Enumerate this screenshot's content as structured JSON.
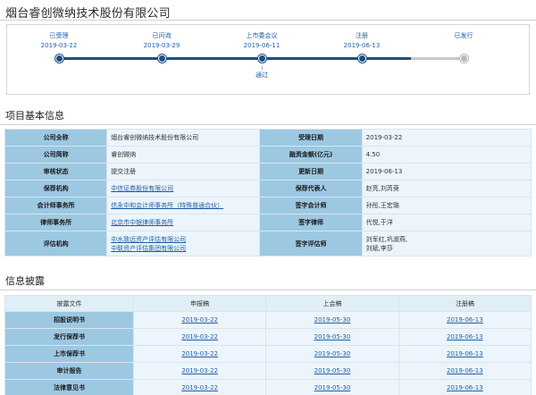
{
  "company_title": "烟台睿创微纳技术股份有限公司",
  "progress": {
    "stages": [
      {
        "label": "已受理",
        "date": "2019-03-22",
        "done": true
      },
      {
        "label": "已问询",
        "date": "2019-03-29",
        "done": true
      },
      {
        "label": "上市委会议",
        "date": "2019-06-11",
        "done": true
      },
      {
        "label": "注册",
        "date": "2019-06-13",
        "done": true
      },
      {
        "label": "已发行",
        "date": "",
        "done": false
      }
    ],
    "sub_step": "通过",
    "colors": {
      "done": "#1c4f84",
      "pending": "#c8c8c8"
    }
  },
  "basic_info": {
    "section_title": "项目基本信息",
    "rows": [
      {
        "l1": "公司全称",
        "v1": "烟台睿创微纳技术股份有限公司",
        "v1_link": false,
        "l2": "受理日期",
        "v2": "2019-03-22",
        "v2_link": false
      },
      {
        "l1": "公司简称",
        "v1": "睿创微纳",
        "v1_link": false,
        "l2": "融资金额(亿元)",
        "v2": "4.50",
        "v2_link": false
      },
      {
        "l1": "审核状态",
        "v1": "提交注册",
        "v1_link": false,
        "l2": "更新日期",
        "v2": "2019-06-13",
        "v2_link": false
      },
      {
        "l1": "保荐机构",
        "v1": "中信证券股份有限公司",
        "v1_link": true,
        "l2": "保荐代表人",
        "v2": "赵亮,刘芮萸",
        "v2_link": false
      },
      {
        "l1": "会计师事务所",
        "v1": "信永中和会计师事务所（特殊普通合伙）",
        "v1_link": true,
        "l2": "签字会计师",
        "v2": "孙彤,王宏璐",
        "v2_link": false
      },
      {
        "l1": "律师事务所",
        "v1": "北京市中银律师事务所",
        "v1_link": true,
        "l2": "签字律师",
        "v2": "代悦,于洋",
        "v2_link": false
      }
    ],
    "assessor_row": {
      "l1": "评估机构",
      "v1": [
        "中水致远资产评估有限公司",
        "中联资产评估集团有限公司"
      ],
      "l2": "签字评估师",
      "v2": [
        "刘军红,巩淑燕,",
        "刘斌,李莎"
      ]
    }
  },
  "disclosure": {
    "section_title": "信息披露",
    "headers": [
      "披露文件",
      "申报稿",
      "上会稿",
      "注册稿"
    ],
    "rows": [
      {
        "name": "招股说明书",
        "dates": [
          "2019-03-22",
          "2019-05-30",
          "2019-06-13"
        ]
      },
      {
        "name": "发行保荐书",
        "dates": [
          "2019-03-22",
          "2019-05-30",
          "2019-06-13"
        ]
      },
      {
        "name": "上市保荐书",
        "dates": [
          "2019-03-22",
          "2019-05-30",
          "2019-06-13"
        ]
      },
      {
        "name": "审计报告",
        "dates": [
          "2019-03-22",
          "2019-05-30",
          "2019-06-13"
        ]
      },
      {
        "name": "法律意见书",
        "dates": [
          "2019-03-22",
          "2019-05-30",
          "2019-06-13"
        ]
      }
    ]
  }
}
